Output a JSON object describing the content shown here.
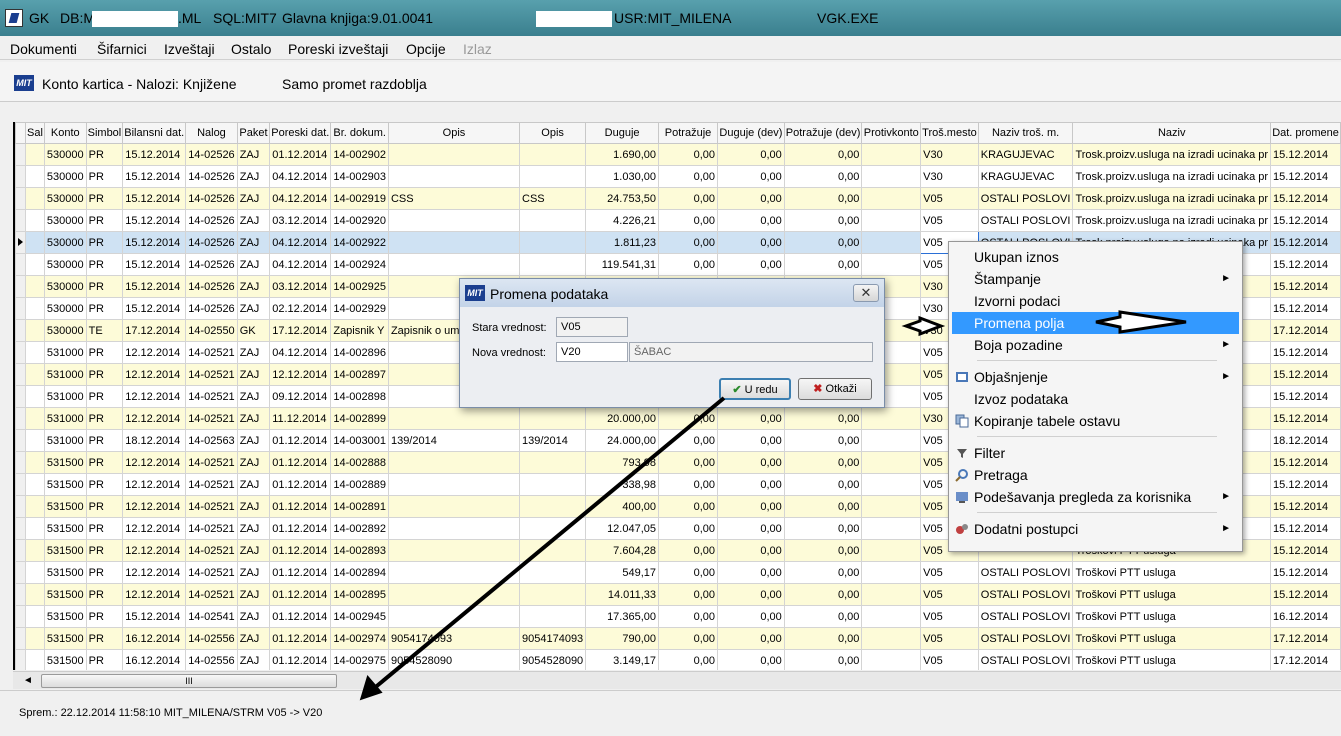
{
  "titlebar": {
    "app": "GK",
    "db_prefix": "DB:M",
    "db_suffix": ".ML",
    "sql": "SQL:MIT7",
    "ledger": "Glavna knjiga:9.01.0041",
    "user": "USR:MIT_MILENA",
    "exe": "VGK.EXE"
  },
  "menu": [
    "Dokumenti",
    "Šifarnici",
    "Izveštaji",
    "Ostalo",
    "Poreski izveštaji",
    "Opcije",
    "Izlaz"
  ],
  "header": {
    "title": "Konto kartica - Nalozi: Knjižene",
    "subtitle": "Samo promet razdoblja",
    "logo": "MIT"
  },
  "columns": [
    "Sal",
    "Konto",
    "Simbol",
    "Bilansni dat.",
    "Nalog",
    "Paket",
    "Poreski dat.",
    "Br. dokum.",
    "Opis",
    "Opis",
    "Duguje",
    "Potražuje",
    "Duguje (dev)",
    "Potražuje (dev)",
    "Protivkonto",
    "Troš.mesto",
    "Naziv troš. m.",
    "Naziv",
    "Dat. promene"
  ],
  "rows": [
    {
      "konto": "530000",
      "simbol": "PR",
      "bdat": "15.12.2014",
      "nalog": "14-02526",
      "paket": "ZAJ",
      "pdat": "01.12.2014",
      "brdok": "14-002902",
      "opis1": "",
      "opis2": "",
      "duguje": "1.690,00",
      "potr": "0,00",
      "dugdev": "0,00",
      "potrdev": "0,00",
      "prot": "",
      "trosm": "V30",
      "naztm": "KRAGUJEVAC",
      "naziv": "Trosk.proizv.usluga na izradi ucinaka pr",
      "datp": "15.12.2014",
      "style": "y"
    },
    {
      "konto": "530000",
      "simbol": "PR",
      "bdat": "15.12.2014",
      "nalog": "14-02526",
      "paket": "ZAJ",
      "pdat": "04.12.2014",
      "brdok": "14-002903",
      "opis1": "",
      "opis2": "",
      "duguje": "1.030,00",
      "potr": "0,00",
      "dugdev": "0,00",
      "potrdev": "0,00",
      "prot": "",
      "trosm": "V30",
      "naztm": "KRAGUJEVAC",
      "naziv": "Trosk.proizv.usluga na izradi ucinaka pr",
      "datp": "15.12.2014",
      "style": "w"
    },
    {
      "konto": "530000",
      "simbol": "PR",
      "bdat": "15.12.2014",
      "nalog": "14-02526",
      "paket": "ZAJ",
      "pdat": "04.12.2014",
      "brdok": "14-002919",
      "opis1": "CSS",
      "opis2": "CSS",
      "duguje": "24.753,50",
      "potr": "0,00",
      "dugdev": "0,00",
      "potrdev": "0,00",
      "prot": "",
      "trosm": "V05",
      "naztm": "OSTALI POSLOVI",
      "naziv": "Trosk.proizv.usluga na izradi ucinaka pr",
      "datp": "15.12.2014",
      "style": "y"
    },
    {
      "konto": "530000",
      "simbol": "PR",
      "bdat": "15.12.2014",
      "nalog": "14-02526",
      "paket": "ZAJ",
      "pdat": "03.12.2014",
      "brdok": "14-002920",
      "opis1": "",
      "opis2": "",
      "duguje": "4.226,21",
      "potr": "0,00",
      "dugdev": "0,00",
      "potrdev": "0,00",
      "prot": "",
      "trosm": "V05",
      "naztm": "OSTALI POSLOVI",
      "naziv": "Trosk.proizv.usluga na izradi ucinaka pr",
      "datp": "15.12.2014",
      "style": "w"
    },
    {
      "konto": "530000",
      "simbol": "PR",
      "bdat": "15.12.2014",
      "nalog": "14-02526",
      "paket": "ZAJ",
      "pdat": "04.12.2014",
      "brdok": "14-002922",
      "opis1": "",
      "opis2": "",
      "duguje": "1.811,23",
      "potr": "0,00",
      "dugdev": "0,00",
      "potrdev": "0,00",
      "prot": "",
      "trosm": "V05",
      "naztm": "OSTALI POSLOVI",
      "naziv": "Trosk.proizv.usluga na izradi ucinaka pr",
      "datp": "15.12.2014",
      "style": "sel"
    },
    {
      "konto": "530000",
      "simbol": "PR",
      "bdat": "15.12.2014",
      "nalog": "14-02526",
      "paket": "ZAJ",
      "pdat": "04.12.2014",
      "brdok": "14-002924",
      "opis1": "",
      "opis2": "",
      "duguje": "119.541,31",
      "potr": "0,00",
      "dugdev": "0,00",
      "potrdev": "0,00",
      "prot": "",
      "trosm": "V05",
      "naztm": "",
      "naziv": "",
      "datp": "15.12.2014",
      "style": "w"
    },
    {
      "konto": "530000",
      "simbol": "PR",
      "bdat": "15.12.2014",
      "nalog": "14-02526",
      "paket": "ZAJ",
      "pdat": "03.12.2014",
      "brdok": "14-002925",
      "opis1": "",
      "opis2": "",
      "duguje": "",
      "potr": "",
      "dugdev": "",
      "potrdev": "",
      "prot": "",
      "trosm": "V30",
      "naztm": "",
      "naziv": "",
      "datp": "15.12.2014",
      "style": "y"
    },
    {
      "konto": "530000",
      "simbol": "PR",
      "bdat": "15.12.2014",
      "nalog": "14-02526",
      "paket": "ZAJ",
      "pdat": "02.12.2014",
      "brdok": "14-002929",
      "opis1": "",
      "opis2": "",
      "duguje": "",
      "potr": "",
      "dugdev": "",
      "potrdev": "",
      "prot": "",
      "trosm": "V30",
      "naztm": "",
      "naziv": "",
      "datp": "15.12.2014",
      "style": "w"
    },
    {
      "konto": "530000",
      "simbol": "TE",
      "bdat": "17.12.2014",
      "nalog": "14-02550",
      "paket": "GK",
      "pdat": "17.12.2014",
      "brdok": "Zapisnik Y",
      "opis1": "Zapisnik o uman",
      "opis2": "",
      "duguje": "",
      "potr": "",
      "dugdev": "",
      "potrdev": "",
      "prot": "",
      "trosm": "V30",
      "naztm": "",
      "naziv": "",
      "datp": "17.12.2014",
      "style": "y"
    },
    {
      "konto": "531000",
      "simbol": "PR",
      "bdat": "12.12.2014",
      "nalog": "14-02521",
      "paket": "ZAJ",
      "pdat": "04.12.2014",
      "brdok": "14-002896",
      "opis1": "",
      "opis2": "",
      "duguje": "",
      "potr": "",
      "dugdev": "",
      "potrdev": "",
      "prot": "",
      "trosm": "V05",
      "naztm": "",
      "naziv": "",
      "datp": "15.12.2014",
      "style": "w"
    },
    {
      "konto": "531000",
      "simbol": "PR",
      "bdat": "12.12.2014",
      "nalog": "14-02521",
      "paket": "ZAJ",
      "pdat": "12.12.2014",
      "brdok": "14-002897",
      "opis1": "",
      "opis2": "",
      "duguje": "",
      "potr": "",
      "dugdev": "",
      "potrdev": "",
      "prot": "",
      "trosm": "V05",
      "naztm": "",
      "naziv": "",
      "datp": "15.12.2014",
      "style": "y"
    },
    {
      "konto": "531000",
      "simbol": "PR",
      "bdat": "12.12.2014",
      "nalog": "14-02521",
      "paket": "ZAJ",
      "pdat": "09.12.2014",
      "brdok": "14-002898",
      "opis1": "",
      "opis2": "",
      "duguje": "",
      "potr": "",
      "dugdev": "",
      "potrdev": "",
      "prot": "",
      "trosm": "V05",
      "naztm": "",
      "naziv": "",
      "datp": "15.12.2014",
      "style": "w"
    },
    {
      "konto": "531000",
      "simbol": "PR",
      "bdat": "12.12.2014",
      "nalog": "14-02521",
      "paket": "ZAJ",
      "pdat": "11.12.2014",
      "brdok": "14-002899",
      "opis1": "",
      "opis2": "",
      "duguje": "20.000,00",
      "potr": "0,00",
      "dugdev": "0,00",
      "potrdev": "0,00",
      "prot": "",
      "trosm": "V30",
      "naztm": "",
      "naziv": "",
      "datp": "15.12.2014",
      "style": "y"
    },
    {
      "konto": "531000",
      "simbol": "PR",
      "bdat": "18.12.2014",
      "nalog": "14-02563",
      "paket": "ZAJ",
      "pdat": "01.12.2014",
      "brdok": "14-003001",
      "opis1": "139/2014",
      "opis2": "139/2014",
      "duguje": "24.000,00",
      "potr": "0,00",
      "dugdev": "0,00",
      "potrdev": "0,00",
      "prot": "",
      "trosm": "V05",
      "naztm": "",
      "naziv": "",
      "datp": "18.12.2014",
      "style": "w"
    },
    {
      "konto": "531500",
      "simbol": "PR",
      "bdat": "12.12.2014",
      "nalog": "14-02521",
      "paket": "ZAJ",
      "pdat": "01.12.2014",
      "brdok": "14-002888",
      "opis1": "",
      "opis2": "",
      "duguje": "793,98",
      "potr": "0,00",
      "dugdev": "0,00",
      "potrdev": "0,00",
      "prot": "",
      "trosm": "V05",
      "naztm": "",
      "naziv": "",
      "datp": "15.12.2014",
      "style": "y"
    },
    {
      "konto": "531500",
      "simbol": "PR",
      "bdat": "12.12.2014",
      "nalog": "14-02521",
      "paket": "ZAJ",
      "pdat": "01.12.2014",
      "brdok": "14-002889",
      "opis1": "",
      "opis2": "",
      "duguje": "338,98",
      "potr": "0,00",
      "dugdev": "0,00",
      "potrdev": "0,00",
      "prot": "",
      "trosm": "V05",
      "naztm": "",
      "naziv": "",
      "datp": "15.12.2014",
      "style": "w"
    },
    {
      "konto": "531500",
      "simbol": "PR",
      "bdat": "12.12.2014",
      "nalog": "14-02521",
      "paket": "ZAJ",
      "pdat": "01.12.2014",
      "brdok": "14-002891",
      "opis1": "",
      "opis2": "",
      "duguje": "400,00",
      "potr": "0,00",
      "dugdev": "0,00",
      "potrdev": "0,00",
      "prot": "",
      "trosm": "V05",
      "naztm": "",
      "naziv": "",
      "datp": "15.12.2014",
      "style": "y"
    },
    {
      "konto": "531500",
      "simbol": "PR",
      "bdat": "12.12.2014",
      "nalog": "14-02521",
      "paket": "ZAJ",
      "pdat": "01.12.2014",
      "brdok": "14-002892",
      "opis1": "",
      "opis2": "",
      "duguje": "12.047,05",
      "potr": "0,00",
      "dugdev": "0,00",
      "potrdev": "0,00",
      "prot": "",
      "trosm": "V05",
      "naztm": "",
      "naziv": "",
      "datp": "15.12.2014",
      "style": "w"
    },
    {
      "konto": "531500",
      "simbol": "PR",
      "bdat": "12.12.2014",
      "nalog": "14-02521",
      "paket": "ZAJ",
      "pdat": "01.12.2014",
      "brdok": "14-002893",
      "opis1": "",
      "opis2": "",
      "duguje": "7.604,28",
      "potr": "0,00",
      "dugdev": "0,00",
      "potrdev": "0,00",
      "prot": "",
      "trosm": "V05",
      "naztm": "",
      "naziv": "Troškovi PTT usluga",
      "datp": "15.12.2014",
      "style": "y"
    },
    {
      "konto": "531500",
      "simbol": "PR",
      "bdat": "12.12.2014",
      "nalog": "14-02521",
      "paket": "ZAJ",
      "pdat": "01.12.2014",
      "brdok": "14-002894",
      "opis1": "",
      "opis2": "",
      "duguje": "549,17",
      "potr": "0,00",
      "dugdev": "0,00",
      "potrdev": "0,00",
      "prot": "",
      "trosm": "V05",
      "naztm": "OSTALI POSLOVI",
      "naziv": "Troškovi PTT usluga",
      "datp": "15.12.2014",
      "style": "w"
    },
    {
      "konto": "531500",
      "simbol": "PR",
      "bdat": "12.12.2014",
      "nalog": "14-02521",
      "paket": "ZAJ",
      "pdat": "01.12.2014",
      "brdok": "14-002895",
      "opis1": "",
      "opis2": "",
      "duguje": "14.011,33",
      "potr": "0,00",
      "dugdev": "0,00",
      "potrdev": "0,00",
      "prot": "",
      "trosm": "V05",
      "naztm": "OSTALI POSLOVI",
      "naziv": "Troškovi PTT usluga",
      "datp": "15.12.2014",
      "style": "y"
    },
    {
      "konto": "531500",
      "simbol": "PR",
      "bdat": "15.12.2014",
      "nalog": "14-02541",
      "paket": "ZAJ",
      "pdat": "01.12.2014",
      "brdok": "14-002945",
      "opis1": "",
      "opis2": "",
      "duguje": "17.365,00",
      "potr": "0,00",
      "dugdev": "0,00",
      "potrdev": "0,00",
      "prot": "",
      "trosm": "V05",
      "naztm": "OSTALI POSLOVI",
      "naziv": "Troškovi PTT usluga",
      "datp": "16.12.2014",
      "style": "w"
    },
    {
      "konto": "531500",
      "simbol": "PR",
      "bdat": "16.12.2014",
      "nalog": "14-02556",
      "paket": "ZAJ",
      "pdat": "01.12.2014",
      "brdok": "14-002974",
      "opis1": "9054174093",
      "opis2": "9054174093",
      "duguje": "790,00",
      "potr": "0,00",
      "dugdev": "0,00",
      "potrdev": "0,00",
      "prot": "",
      "trosm": "V05",
      "naztm": "OSTALI POSLOVI",
      "naziv": "Troškovi PTT usluga",
      "datp": "17.12.2014",
      "style": "y"
    },
    {
      "konto": "531500",
      "simbol": "PR",
      "bdat": "16.12.2014",
      "nalog": "14-02556",
      "paket": "ZAJ",
      "pdat": "01.12.2014",
      "brdok": "14-002975",
      "opis1": "9054528090",
      "opis2": "9054528090",
      "duguje": "3.149,17",
      "potr": "0,00",
      "dugdev": "0,00",
      "potrdev": "0,00",
      "prot": "",
      "trosm": "V05",
      "naztm": "OSTALI POSLOVI",
      "naziv": "Troškovi PTT usluga",
      "datp": "17.12.2014",
      "style": "w"
    }
  ],
  "dialog": {
    "title": "Promena podataka",
    "old_label": "Stara vrednost:",
    "old_value": "V05",
    "new_label": "Nova vrednost:",
    "new_value": "V20",
    "new_desc": "ŠABAC",
    "ok": "U redu",
    "cancel": "Otkaži"
  },
  "context_menu": [
    "Ukupan iznos",
    "Štampanje",
    "Izvorni podaci",
    "Promena polja",
    "Boja pozadine",
    "Objašnjenje",
    "Izvoz podataka",
    "Kopiranje tabele ostavu",
    "Filter",
    "Pretraga",
    "Podešavanja pregleda za korisnika",
    "Dodatni postupci"
  ],
  "status": "Sprem.: 22.12.2014 11:58:10 MIT_MILENA/STRM  V05   -> V20",
  "scroll_thumb": "III"
}
